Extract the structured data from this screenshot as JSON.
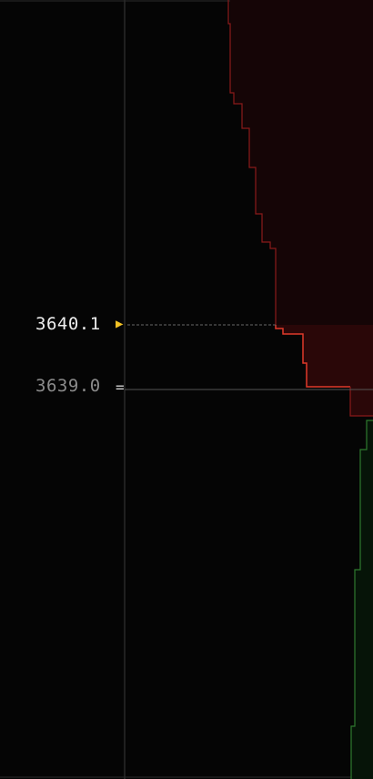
{
  "ladder": {
    "last_price": "3640.1",
    "mid_price": "3639.0",
    "last_price_marker_icon": "right-triangle-icon",
    "mid_price_marker_icon": "equals-icon",
    "colors": {
      "background": "#050505",
      "divider": "#3a3a3a",
      "ask_fill": "#150506",
      "ask_line": "#8b1a1a",
      "ask_near_fill": "#2a0708",
      "ask_near_line": "#e03a2a",
      "bid_fill": "#061408",
      "bid_line": "#2f7a2f",
      "last_price": "#ececec",
      "mid_price": "#8b8b8b",
      "last_price_marker": "#f3c325"
    }
  }
}
